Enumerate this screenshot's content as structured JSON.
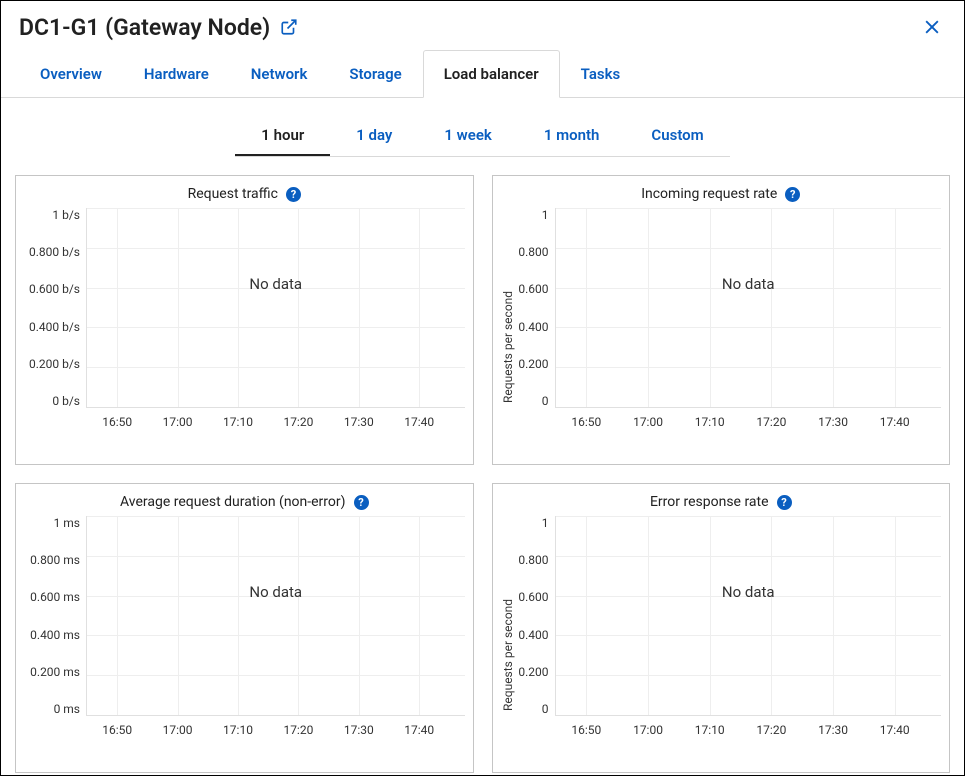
{
  "header": {
    "title": "DC1-G1 (Gateway Node)"
  },
  "tabs": {
    "overview": "Overview",
    "hardware": "Hardware",
    "network": "Network",
    "storage": "Storage",
    "load_balancer": "Load balancer",
    "tasks": "Tasks"
  },
  "time_tabs": {
    "hour": "1 hour",
    "day": "1 day",
    "week": "1 week",
    "month": "1 month",
    "custom": "Custom"
  },
  "charts": {
    "request_traffic": {
      "title": "Request traffic",
      "y_label": "",
      "no_data": "No data"
    },
    "incoming_rate": {
      "title": "Incoming request rate",
      "y_label": "Requests per second",
      "no_data": "No data"
    },
    "avg_duration": {
      "title": "Average request duration (non-error)",
      "y_label": "",
      "no_data": "No data"
    },
    "error_rate": {
      "title": "Error response rate",
      "y_label": "Requests per second",
      "no_data": "No data"
    }
  },
  "chart_data": [
    {
      "type": "line",
      "title": "Request traffic",
      "x": [
        "16:50",
        "17:00",
        "17:10",
        "17:20",
        "17:30",
        "17:40"
      ],
      "series": [],
      "y_ticks": [
        "1 b/s",
        "0.800 b/s",
        "0.600 b/s",
        "0.400 b/s",
        "0.200 b/s",
        "0 b/s"
      ],
      "ylim": [
        0,
        1
      ],
      "ylabel": "",
      "xlabel": "",
      "empty": true
    },
    {
      "type": "line",
      "title": "Incoming request rate",
      "x": [
        "16:50",
        "17:00",
        "17:10",
        "17:20",
        "17:30",
        "17:40"
      ],
      "series": [],
      "y_ticks": [
        "1",
        "0.800",
        "0.600",
        "0.400",
        "0.200",
        "0"
      ],
      "ylim": [
        0,
        1
      ],
      "ylabel": "Requests per second",
      "xlabel": "",
      "empty": true
    },
    {
      "type": "line",
      "title": "Average request duration (non-error)",
      "x": [
        "16:50",
        "17:00",
        "17:10",
        "17:20",
        "17:30",
        "17:40"
      ],
      "series": [],
      "y_ticks": [
        "1 ms",
        "0.800 ms",
        "0.600 ms",
        "0.400 ms",
        "0.200 ms",
        "0 ms"
      ],
      "ylim": [
        0,
        1
      ],
      "ylabel": "",
      "xlabel": "",
      "empty": true
    },
    {
      "type": "line",
      "title": "Error response rate",
      "x": [
        "16:50",
        "17:00",
        "17:10",
        "17:20",
        "17:30",
        "17:40"
      ],
      "series": [],
      "y_ticks": [
        "1",
        "0.800",
        "0.600",
        "0.400",
        "0.200",
        "0"
      ],
      "ylim": [
        0,
        1
      ],
      "ylabel": "Requests per second",
      "xlabel": "",
      "empty": true
    }
  ]
}
